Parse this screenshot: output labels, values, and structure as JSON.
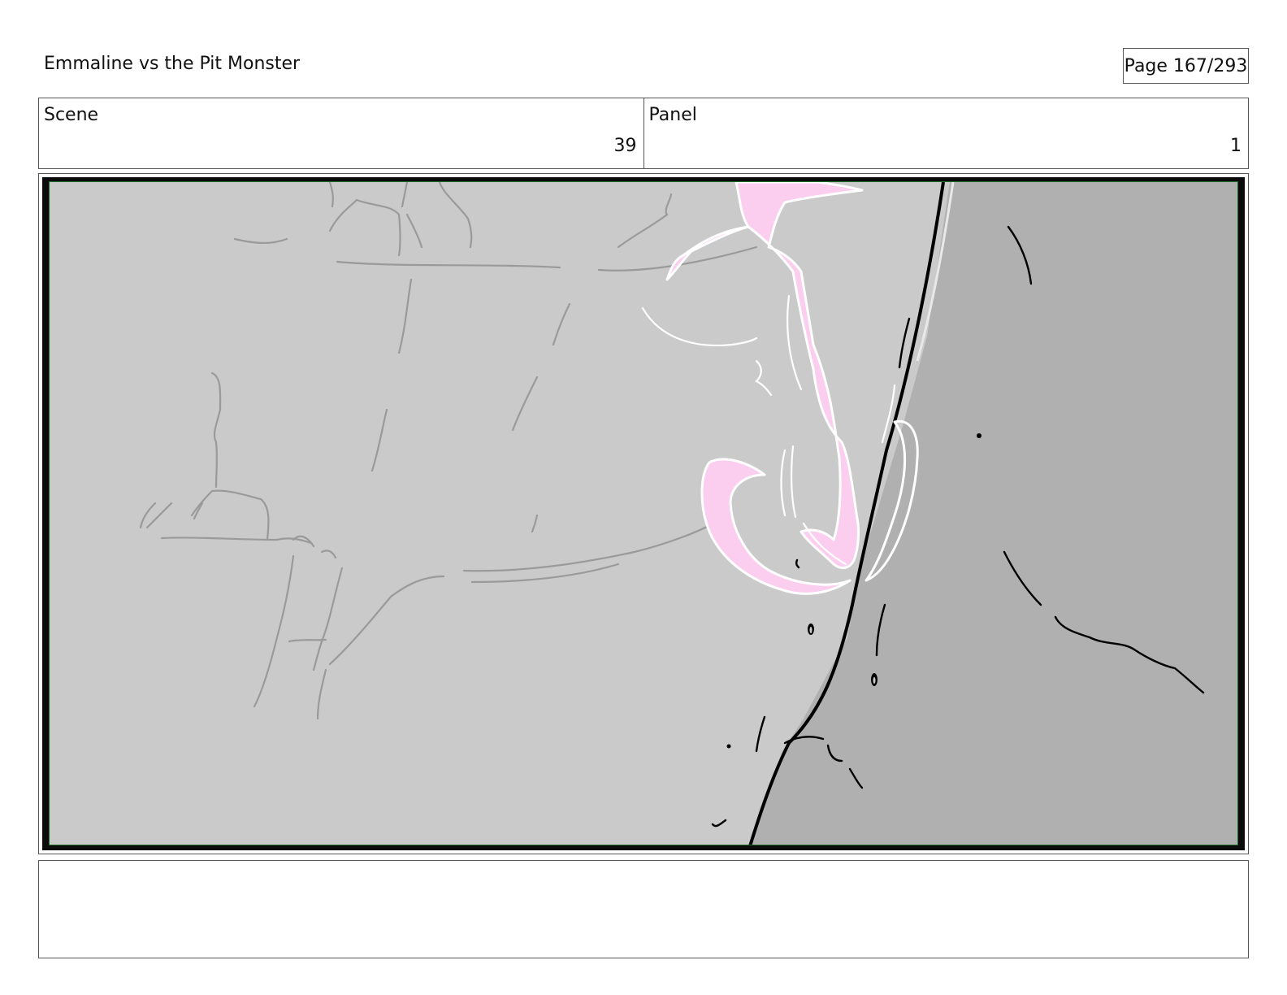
{
  "header": {
    "title": "Emmaline vs the Pit Monster",
    "page_label": "Page 167/293"
  },
  "info": {
    "scene_label": "Scene",
    "scene_value": "39",
    "panel_label": "Panel",
    "panel_value": "1"
  },
  "notes": {
    "text": ""
  },
  "colors": {
    "wall_light": "#cacaca",
    "wall_dark": "#b0b0b0",
    "figure": "#fbcdee",
    "frame": "#0b0b0b"
  }
}
